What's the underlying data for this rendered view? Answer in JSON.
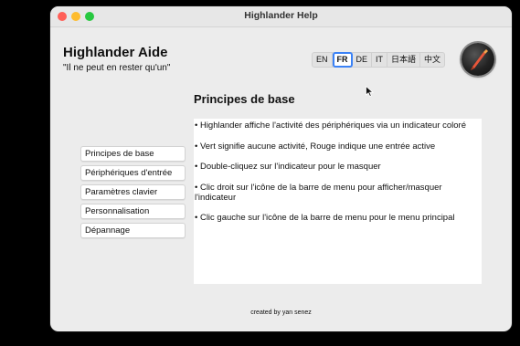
{
  "window": {
    "title": "Highlander Help"
  },
  "header": {
    "app_title": "Highlander Aide",
    "subtitle": "\"Il ne peut en rester qu'un\""
  },
  "languages": [
    {
      "label": "EN",
      "selected": false
    },
    {
      "label": "FR",
      "selected": true
    },
    {
      "label": "DE",
      "selected": false
    },
    {
      "label": "IT",
      "selected": false
    },
    {
      "label": "日本語",
      "selected": false
    },
    {
      "label": "中文",
      "selected": false
    }
  ],
  "section": {
    "title": "Principes de base"
  },
  "sidebar": {
    "items": [
      {
        "label": "Principes de base"
      },
      {
        "label": "Périphériques d'entrée"
      },
      {
        "label": "Paramètres clavier"
      },
      {
        "label": "Personnalisation"
      },
      {
        "label": "Dépannage"
      }
    ]
  },
  "content": {
    "lines": [
      "• Highlander affiche l'activité des périphériques via un indicateur coloré",
      "• Vert signifie aucune activité, Rouge indique une entrée active",
      "• Double-cliquez sur l'indicateur pour le masquer",
      "• Clic droit sur l'icône de la barre de menu pour afficher/masquer l'indicateur",
      "• Clic gauche sur l'icône de la barre de menu pour le menu principal"
    ]
  },
  "footer": {
    "credit": "created by yan senez"
  },
  "icons": {
    "app": "highlander-app-icon",
    "cursor": "mouse-pointer-icon"
  },
  "colors": {
    "accent": "#3b82f6",
    "window_bg": "#ececec",
    "close": "#ff5f57",
    "minimize": "#febc2e",
    "maximize": "#28c840"
  }
}
